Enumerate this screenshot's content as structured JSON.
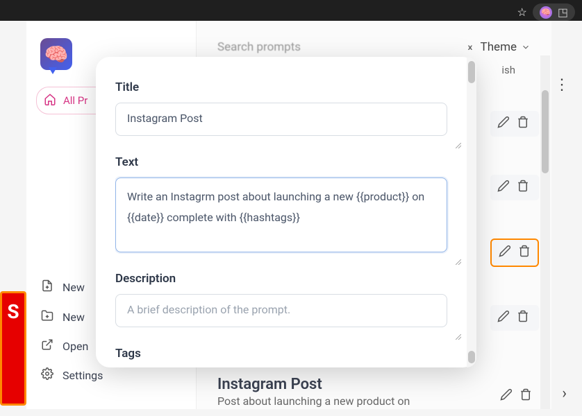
{
  "browser": {
    "star": "☆",
    "puzzle": "◳"
  },
  "sidebar": {
    "all_prompts": "All Pr",
    "items": {
      "new1": "New",
      "new2": "New",
      "open": "Open",
      "settings": "Settings"
    }
  },
  "header": {
    "search_placeholder": "Search prompts",
    "theme": "Theme",
    "lang_fragment": "ish"
  },
  "bottom_card": {
    "title": "Instagram Post",
    "subtitle": "Post about launching a new product on"
  },
  "modal": {
    "title_label": "Title",
    "title_value": "Instagram Post",
    "text_label": "Text",
    "text_value": "Write an Instagrm post about launching a new {{product}} on {{date}} complete with {{hashtags}}",
    "description_label": "Description",
    "description_placeholder": "A brief description of the prompt.",
    "tags_label": "Tags"
  },
  "red_letter": "S"
}
